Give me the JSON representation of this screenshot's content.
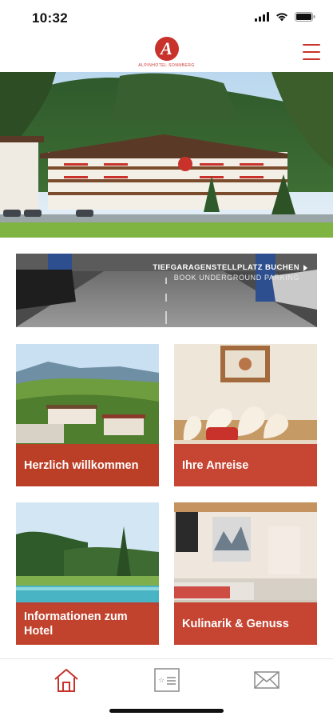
{
  "status_bar": {
    "time": "10:32",
    "icons": [
      "signal-icon",
      "wifi-icon",
      "battery-icon"
    ]
  },
  "header": {
    "logo_text": "ALPINHOTEL SONNBERG",
    "menu_icon": "hamburger-menu-icon"
  },
  "banner": {
    "title": "TIEFGARAGENSTELLPLATZ BUCHEN",
    "subtitle": "BOOK UNDERGROUND PARKING",
    "arrow_icon": "chevron-right-icon"
  },
  "tiles": [
    {
      "label": "Herzlich willkommen"
    },
    {
      "label": "Ihre Anreise"
    },
    {
      "label": "Informationen zum Hotel"
    },
    {
      "label": "Kulinarik & Genuss"
    }
  ],
  "bottom_nav": {
    "items": [
      {
        "icon": "home-icon",
        "active": true
      },
      {
        "icon": "card-icon",
        "active": false
      },
      {
        "icon": "mail-icon",
        "active": false
      }
    ]
  },
  "colors": {
    "accent": "#c8322a",
    "caption_bg": "#c43826",
    "inactive_icon": "#8a8a8a"
  }
}
